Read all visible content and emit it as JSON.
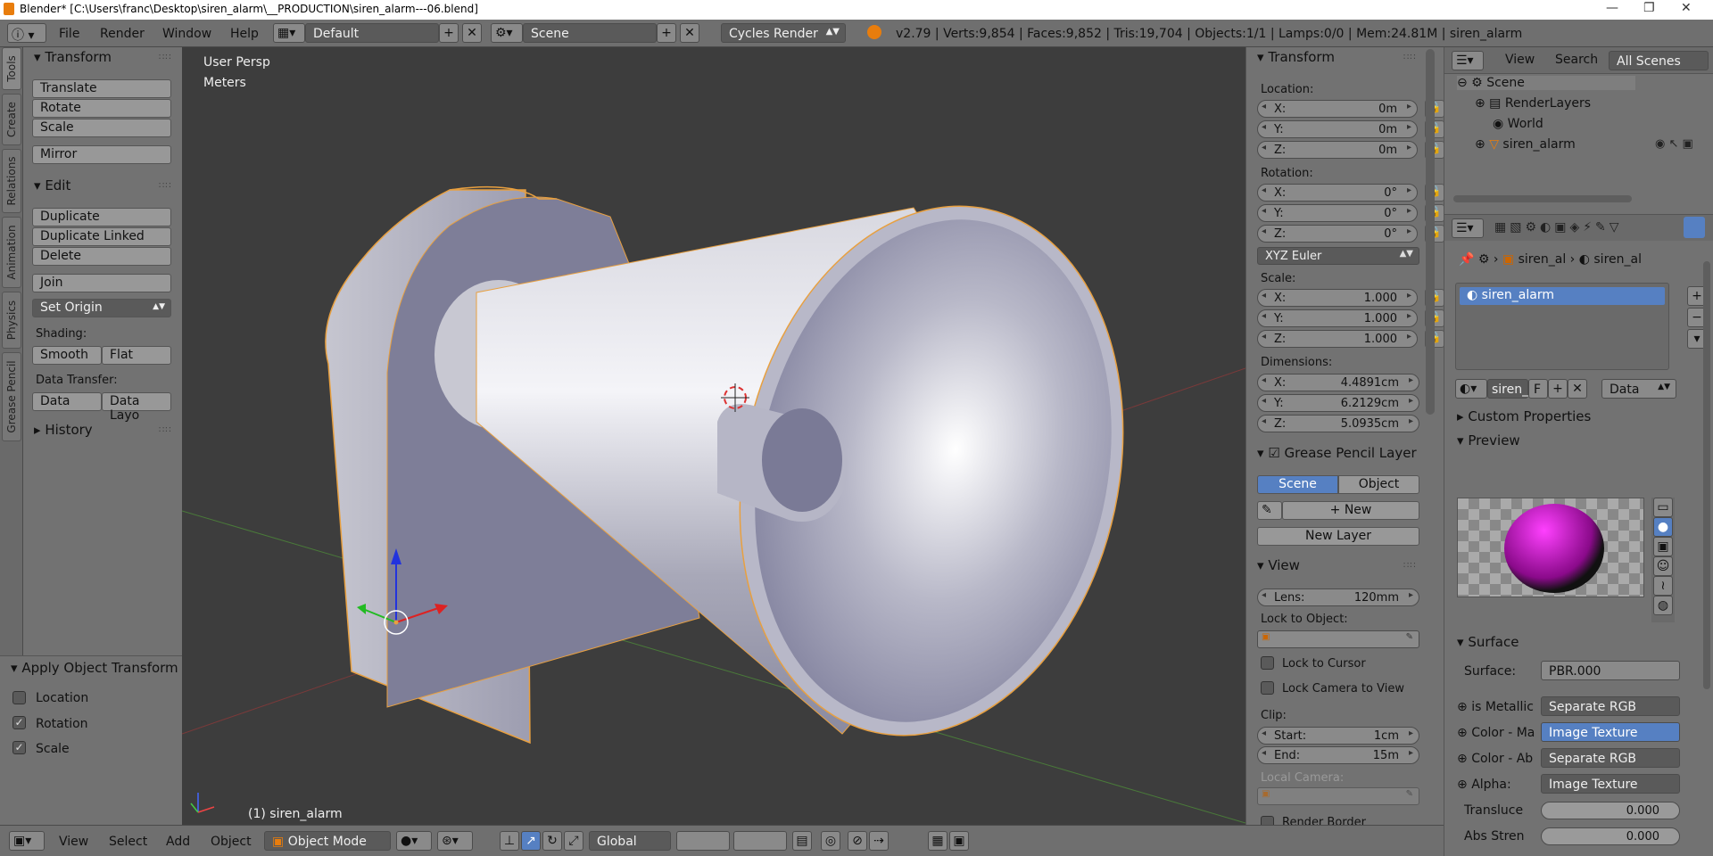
{
  "window": {
    "title": "Blender* [C:\\Users\\franc\\Desktop\\siren_alarm\\__PRODUCTION\\siren_alarm---06.blend]",
    "controls": [
      "—",
      "❐",
      "✕"
    ]
  },
  "topbar": {
    "menus": [
      "File",
      "Render",
      "Window",
      "Help"
    ],
    "screen_layout": "Default",
    "scene": "Scene",
    "render_engine": "Cycles Render",
    "stats": "v2.79 | Verts:9,854 | Faces:9,852 | Tris:19,704 | Objects:1/1 | Lamps:0/0 | Mem:24.81M | siren_alarm"
  },
  "left_tabs": [
    "Tools",
    "Create",
    "Relations",
    "Animation",
    "Physics",
    "Grease Pencil"
  ],
  "tools": {
    "transform_header": "Transform",
    "transform_buttons": [
      "Translate",
      "Rotate",
      "Scale"
    ],
    "mirror": "Mirror",
    "edit_header": "Edit",
    "edit_buttons": [
      "Duplicate",
      "Duplicate Linked",
      "Delete"
    ],
    "join": "Join",
    "set_origin": "Set Origin",
    "shading_label": "Shading:",
    "smooth": "Smooth",
    "flat": "Flat",
    "data_transfer_label": "Data Transfer:",
    "data": "Data",
    "data_layout": "Data Layo",
    "history": "History"
  },
  "operator_panel": {
    "title": "Apply Object Transform",
    "options": [
      {
        "label": "Location",
        "checked": false
      },
      {
        "label": "Rotation",
        "checked": true
      },
      {
        "label": "Scale",
        "checked": true
      }
    ]
  },
  "viewport": {
    "view_name": "User Persp",
    "units": "Meters",
    "object_label": "(1) siren_alarm"
  },
  "npanel": {
    "transform_header": "Transform",
    "location_label": "Location:",
    "location": [
      {
        "k": "X:",
        "v": "0m"
      },
      {
        "k": "Y:",
        "v": "0m"
      },
      {
        "k": "Z:",
        "v": "0m"
      }
    ],
    "rotation_label": "Rotation:",
    "rotation": [
      {
        "k": "X:",
        "v": "0°"
      },
      {
        "k": "Y:",
        "v": "0°"
      },
      {
        "k": "Z:",
        "v": "0°"
      }
    ],
    "rotation_mode": "XYZ Euler",
    "scale_label": "Scale:",
    "scale": [
      {
        "k": "X:",
        "v": "1.000"
      },
      {
        "k": "Y:",
        "v": "1.000"
      },
      {
        "k": "Z:",
        "v": "1.000"
      }
    ],
    "dimensions_label": "Dimensions:",
    "dimensions": [
      {
        "k": "X:",
        "v": "4.4891cm"
      },
      {
        "k": "Y:",
        "v": "6.2129cm"
      },
      {
        "k": "Z:",
        "v": "5.0935cm"
      }
    ],
    "grease_header": "Grease Pencil Layer",
    "scene_tab": "Scene",
    "object_tab": "Object",
    "new": "New",
    "new_layer": "New Layer",
    "view_header": "View",
    "lens_label": "Lens:",
    "lens": "120mm",
    "lock_to_object": "Lock to Object:",
    "lock_to_cursor": "Lock to Cursor",
    "lock_camera": "Lock Camera to View",
    "clip_label": "Clip:",
    "clip_start_label": "Start:",
    "clip_start": "1cm",
    "clip_end_label": "End:",
    "clip_end": "15m",
    "local_camera": "Local Camera:",
    "render_border": "Render Border"
  },
  "outliner": {
    "view": "View",
    "search": "Search",
    "filter": "All Scenes",
    "items": [
      "Scene",
      "RenderLayers",
      "World",
      "siren_alarm"
    ]
  },
  "properties": {
    "breadcrumb": [
      "siren_al",
      "siren_al"
    ],
    "material_slot": "siren_alarm",
    "material_name": "siren_",
    "f_label": "F",
    "data_dropdown": "Data",
    "custom_properties": "Custom Properties",
    "preview": "Preview",
    "surface_header": "Surface",
    "surface_label": "Surface:",
    "surface_value": "PBR.000",
    "inputs": [
      {
        "k": "is Metallic",
        "v": "Separate RGB"
      },
      {
        "k": "Color - Ma",
        "v": "Image Texture"
      },
      {
        "k": "Color - Ab",
        "v": "Separate RGB"
      },
      {
        "k": "Alpha:",
        "v": "Image Texture"
      }
    ],
    "translucent_label": "Transluce",
    "translucent": "0.000",
    "abs_label": "Abs Stren",
    "abs": "0.000"
  },
  "bottombar": {
    "menus": [
      "View",
      "Select",
      "Add",
      "Object"
    ],
    "mode": "Object Mode",
    "orientation": "Global"
  },
  "colors": {
    "panel": "#727272",
    "viewport": "#3d3d3d",
    "selection": "#5680c2",
    "object_outline": "#e8a040"
  }
}
